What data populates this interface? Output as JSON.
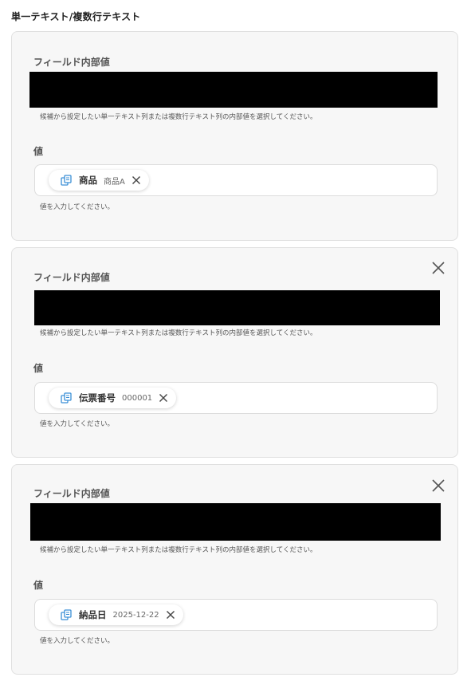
{
  "section_title": "単一テキスト/複数行テキスト",
  "colors": {
    "card_bg": "#f7f7f7",
    "card_border": "#e0e0e0",
    "chip_icon": "#3a8fd6",
    "redacted": "#000000"
  },
  "items": [
    {
      "field_label": "フィールド内部値",
      "field_help": "候補から設定したい単一テキスト列または複数行テキスト列の内部値を選択してください。",
      "value_label": "値",
      "value_help": "値を入力してください。",
      "chip": {
        "icon": "copy-icon",
        "name": "商品",
        "value": "商品A"
      },
      "closable": false
    },
    {
      "field_label": "フィールド内部値",
      "field_help": "候補から設定したい単一テキスト列または複数行テキスト列の内部値を選択してください。",
      "value_label": "値",
      "value_help": "値を入力してください。",
      "chip": {
        "icon": "copy-icon",
        "name": "伝票番号",
        "value": "000001"
      },
      "closable": true
    },
    {
      "field_label": "フィールド内部値",
      "field_help": "候補から設定したい単一テキスト列または複数行テキスト列の内部値を選択してください。",
      "value_label": "値",
      "value_help": "値を入力してください。",
      "chip": {
        "icon": "copy-icon",
        "name": "納品日",
        "value": "2025-12-22"
      },
      "closable": true
    }
  ]
}
